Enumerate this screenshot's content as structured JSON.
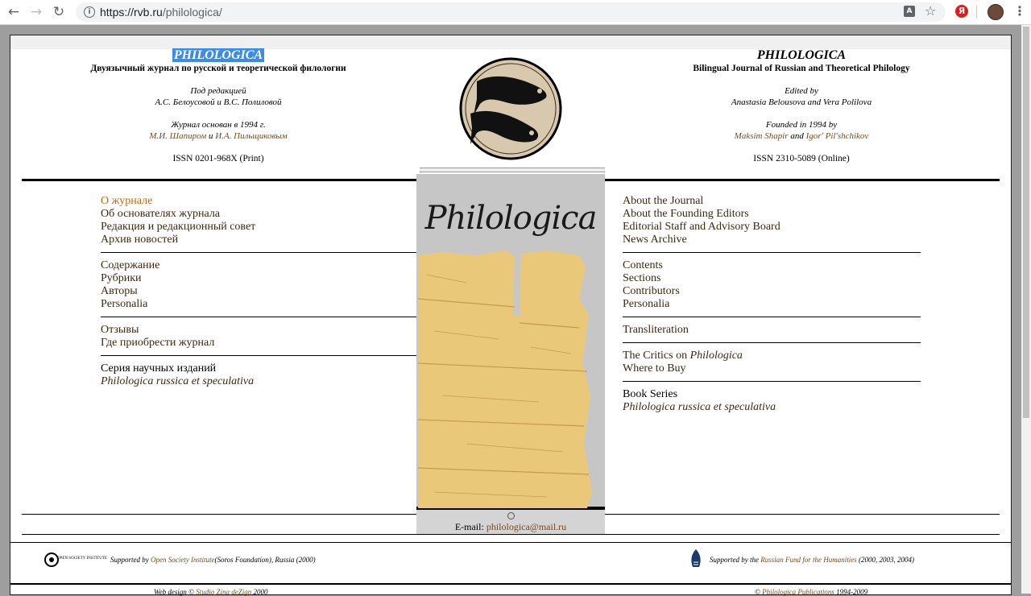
{
  "browser": {
    "url_base": "https://rvb.ru",
    "url_path": "/philologica/",
    "translate_glyph": "A",
    "yandex_glyph": "Я"
  },
  "ru": {
    "title": "PHILOLOGICA",
    "subtitle": "Двуязычный журнал по русской и теоретической филологии",
    "edited_label": "Под редакцией",
    "editors": "А.С. Белоусовой и В.С. Полиловой",
    "founded_label": "Журнал основан в 1994 г.",
    "founder1": "М.И. Шапиром",
    "and": "и",
    "founder2": "И.А. Пильщиковым",
    "issn": "ISSN 0201-968X (Print)"
  },
  "en": {
    "title": "PHILOLOGICA",
    "subtitle": "Bilingual Journal of Russian and Theoretical Philology",
    "edited_label": "Edited by",
    "editors": "Anastasia Belousova and Vera Polilova",
    "founded_label": "Founded in 1994 by",
    "founder1": "Maksim Shapir",
    "and": "and",
    "founder2": "Igor' Pil'shchikov",
    "issn": "ISSN 2310-5089 (Online)"
  },
  "menu_ru": {
    "about": "О журнале",
    "founders": "Об основателях журнала",
    "staff": "Редакция и редакционный совет",
    "news": "Архив новостей",
    "contents": "Содержание",
    "sections": "Рубрики",
    "authors": "Авторы",
    "personalia": "Personalia",
    "reviews": "Отзывы",
    "buy": "Где приобрести журнал",
    "series": "Серия научных изданий",
    "series_title": "Philologica russica et speculativa"
  },
  "menu_en": {
    "about": "About the Journal",
    "founders": "About the Founding Editors",
    "staff": "Editorial Staff and Advisory Board",
    "news": "News Archive",
    "contents": "Contents",
    "sections": "Sections",
    "contributors": "Contributors",
    "personalia": "Personalia",
    "transliteration": "Transliteration",
    "critics_prefix": "The Critics on",
    "critics_title": "Philologica",
    "buy": "Where to Buy",
    "series": "Book Series",
    "series_title": "Philologica russica et speculativa"
  },
  "cover": {
    "title": "Philologica"
  },
  "contact": {
    "label": "E-mail:",
    "email": "philologica@mail.ru"
  },
  "support": {
    "osi_logo_text": "OPEN SOCIETY INSTITUTE",
    "osi_prefix": "Supported by",
    "osi_link": "Open Society Institute",
    "osi_suffix": "(Soros Foundation), Russia (2000)",
    "rfh_prefix": "Supported by the",
    "rfh_link": "Russian Fund for the Humanities",
    "rfh_suffix": "(2000, 2003, 2004)"
  },
  "credits": {
    "design_prefix": "Web design ©",
    "design_link": "Studio Zina deZign",
    "design_year": "2000",
    "copyright_prefix": "©",
    "copyright_link": "Philologica Publications",
    "copyright_years": "1994-2009"
  }
}
